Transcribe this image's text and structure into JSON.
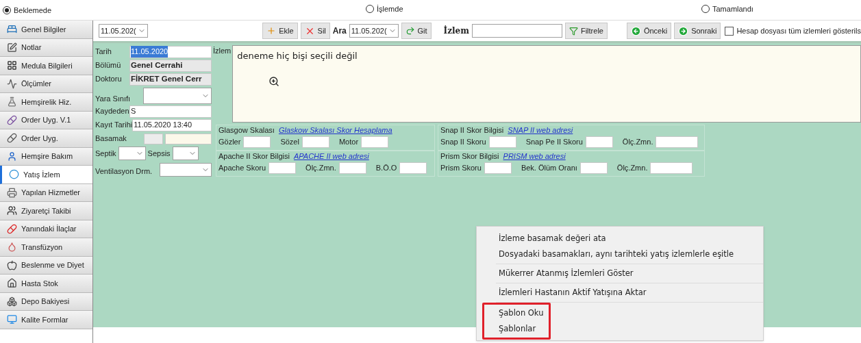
{
  "status_radios": [
    {
      "label": "Beklemede",
      "selected": true
    },
    {
      "label": "İşlemde",
      "selected": false
    },
    {
      "label": "Tamamlandı",
      "selected": false
    }
  ],
  "sidebar": {
    "items": [
      {
        "label": "Genel Bilgiler",
        "selected": false
      },
      {
        "label": "Notlar",
        "selected": false
      },
      {
        "label": "Medula Bilgileri",
        "selected": false
      },
      {
        "label": "Ölçümler",
        "selected": false
      },
      {
        "label": "Hemşirelik Hiz.",
        "selected": false
      },
      {
        "label": "Order Uyg. V.1",
        "selected": false
      },
      {
        "label": "Order Uyg.",
        "selected": false
      },
      {
        "label": "Hemşire Bakım",
        "selected": false
      },
      {
        "label": "Yatış İzlem",
        "selected": true
      },
      {
        "label": "Yapılan Hizmetler",
        "selected": false
      },
      {
        "label": "Ziyaretçi Takibi",
        "selected": false
      },
      {
        "label": "Yanındaki İlaçlar",
        "selected": false
      },
      {
        "label": "Transfüzyon",
        "selected": false
      },
      {
        "label": "Beslenme ve Diyet",
        "selected": false
      },
      {
        "label": "Hasta Stok",
        "selected": false
      },
      {
        "label": "Depo Bakiyesi",
        "selected": false
      },
      {
        "label": "Kalite Formlar",
        "selected": false
      }
    ]
  },
  "toolbar": {
    "date_select": "11.05.202(",
    "add_button": "Ekle",
    "delete_button": "Sil",
    "search_label": "Ara",
    "search_date": "11.05.202(",
    "go_button": "Git",
    "filter_label": "İzlem",
    "filter_button": "Filtrele",
    "prev_button": "Önceki",
    "next_button": "Sonraki",
    "show_all": {
      "label": "Hesap dosyası tüm izlemleri gösterils",
      "checked": false
    }
  },
  "form": {
    "rows": [
      {
        "kind": "text",
        "label": "Tarih",
        "value": "11.05.2020",
        "selected": true
      },
      {
        "kind": "readonly",
        "label": "Bölümü",
        "value": "Genel Cerrahi"
      },
      {
        "kind": "readonly",
        "label": "Doktoru",
        "value": "FİKRET Genel Cerr"
      },
      {
        "kind": "dropdown",
        "label": "Yara Sınıfı"
      },
      {
        "kind": "text",
        "label": "Kaydeden",
        "value": "S",
        "selected": false
      },
      {
        "kind": "text",
        "label": "Kayıt Tarihi",
        "value": "11.05.2020 13:40",
        "selected": false
      },
      {
        "kind": "double-box",
        "label": "Basamak"
      },
      {
        "kind": "two-dropdowns",
        "label": "Septik",
        "label_2": "Sepsis"
      },
      {
        "kind": "dropdown",
        "label": "Ventilasyon Drm."
      }
    ]
  },
  "note": {
    "label": "İzlem",
    "text": "deneme hiç bişi seçili değil"
  },
  "score_groups": [
    [
      {
        "title": "Glasgow Skalası",
        "link": "Glaskow Skalası Skor Hesaplama",
        "fields": [
          "Gözler",
          "Sözel",
          "Motor"
        ]
      },
      {
        "title": "Apache II Skor Bilgisi",
        "link": "APACHE II web adresi",
        "fields": [
          "Apache Skoru",
          "Ölç.Zmn.",
          "B.Ö.O"
        ]
      }
    ],
    [
      {
        "title": "Snap II Skor Bilgisi",
        "link": "SNAP II web adresi",
        "fields": [
          "Snap II Skoru",
          "Snap Pe II Skoru",
          "Ölç.Zmn."
        ]
      },
      {
        "title": "Prism Skor Bilgisi",
        "link": "PRISM web adresi",
        "fields": [
          "Prism Skoru",
          "Bek. Ölüm Oranı",
          "Ölç.Zmn."
        ]
      }
    ]
  ],
  "context_menu": {
    "sections": [
      {
        "highlighted": false,
        "items": [
          "İzleme basamak değeri ata",
          "Dosyadaki basamakları, aynı tarihteki yatış izlemlerle eşitle"
        ]
      },
      {
        "highlighted": false,
        "items": [
          "Mükerrer Atanmış İzlemleri Göster"
        ]
      },
      {
        "highlighted": false,
        "items": [
          "İzlemleri Hastanın Aktif Yatışına Aktar"
        ]
      },
      {
        "highlighted": true,
        "items": [
          "Şablon Oku",
          "Şablonlar"
        ]
      }
    ]
  }
}
